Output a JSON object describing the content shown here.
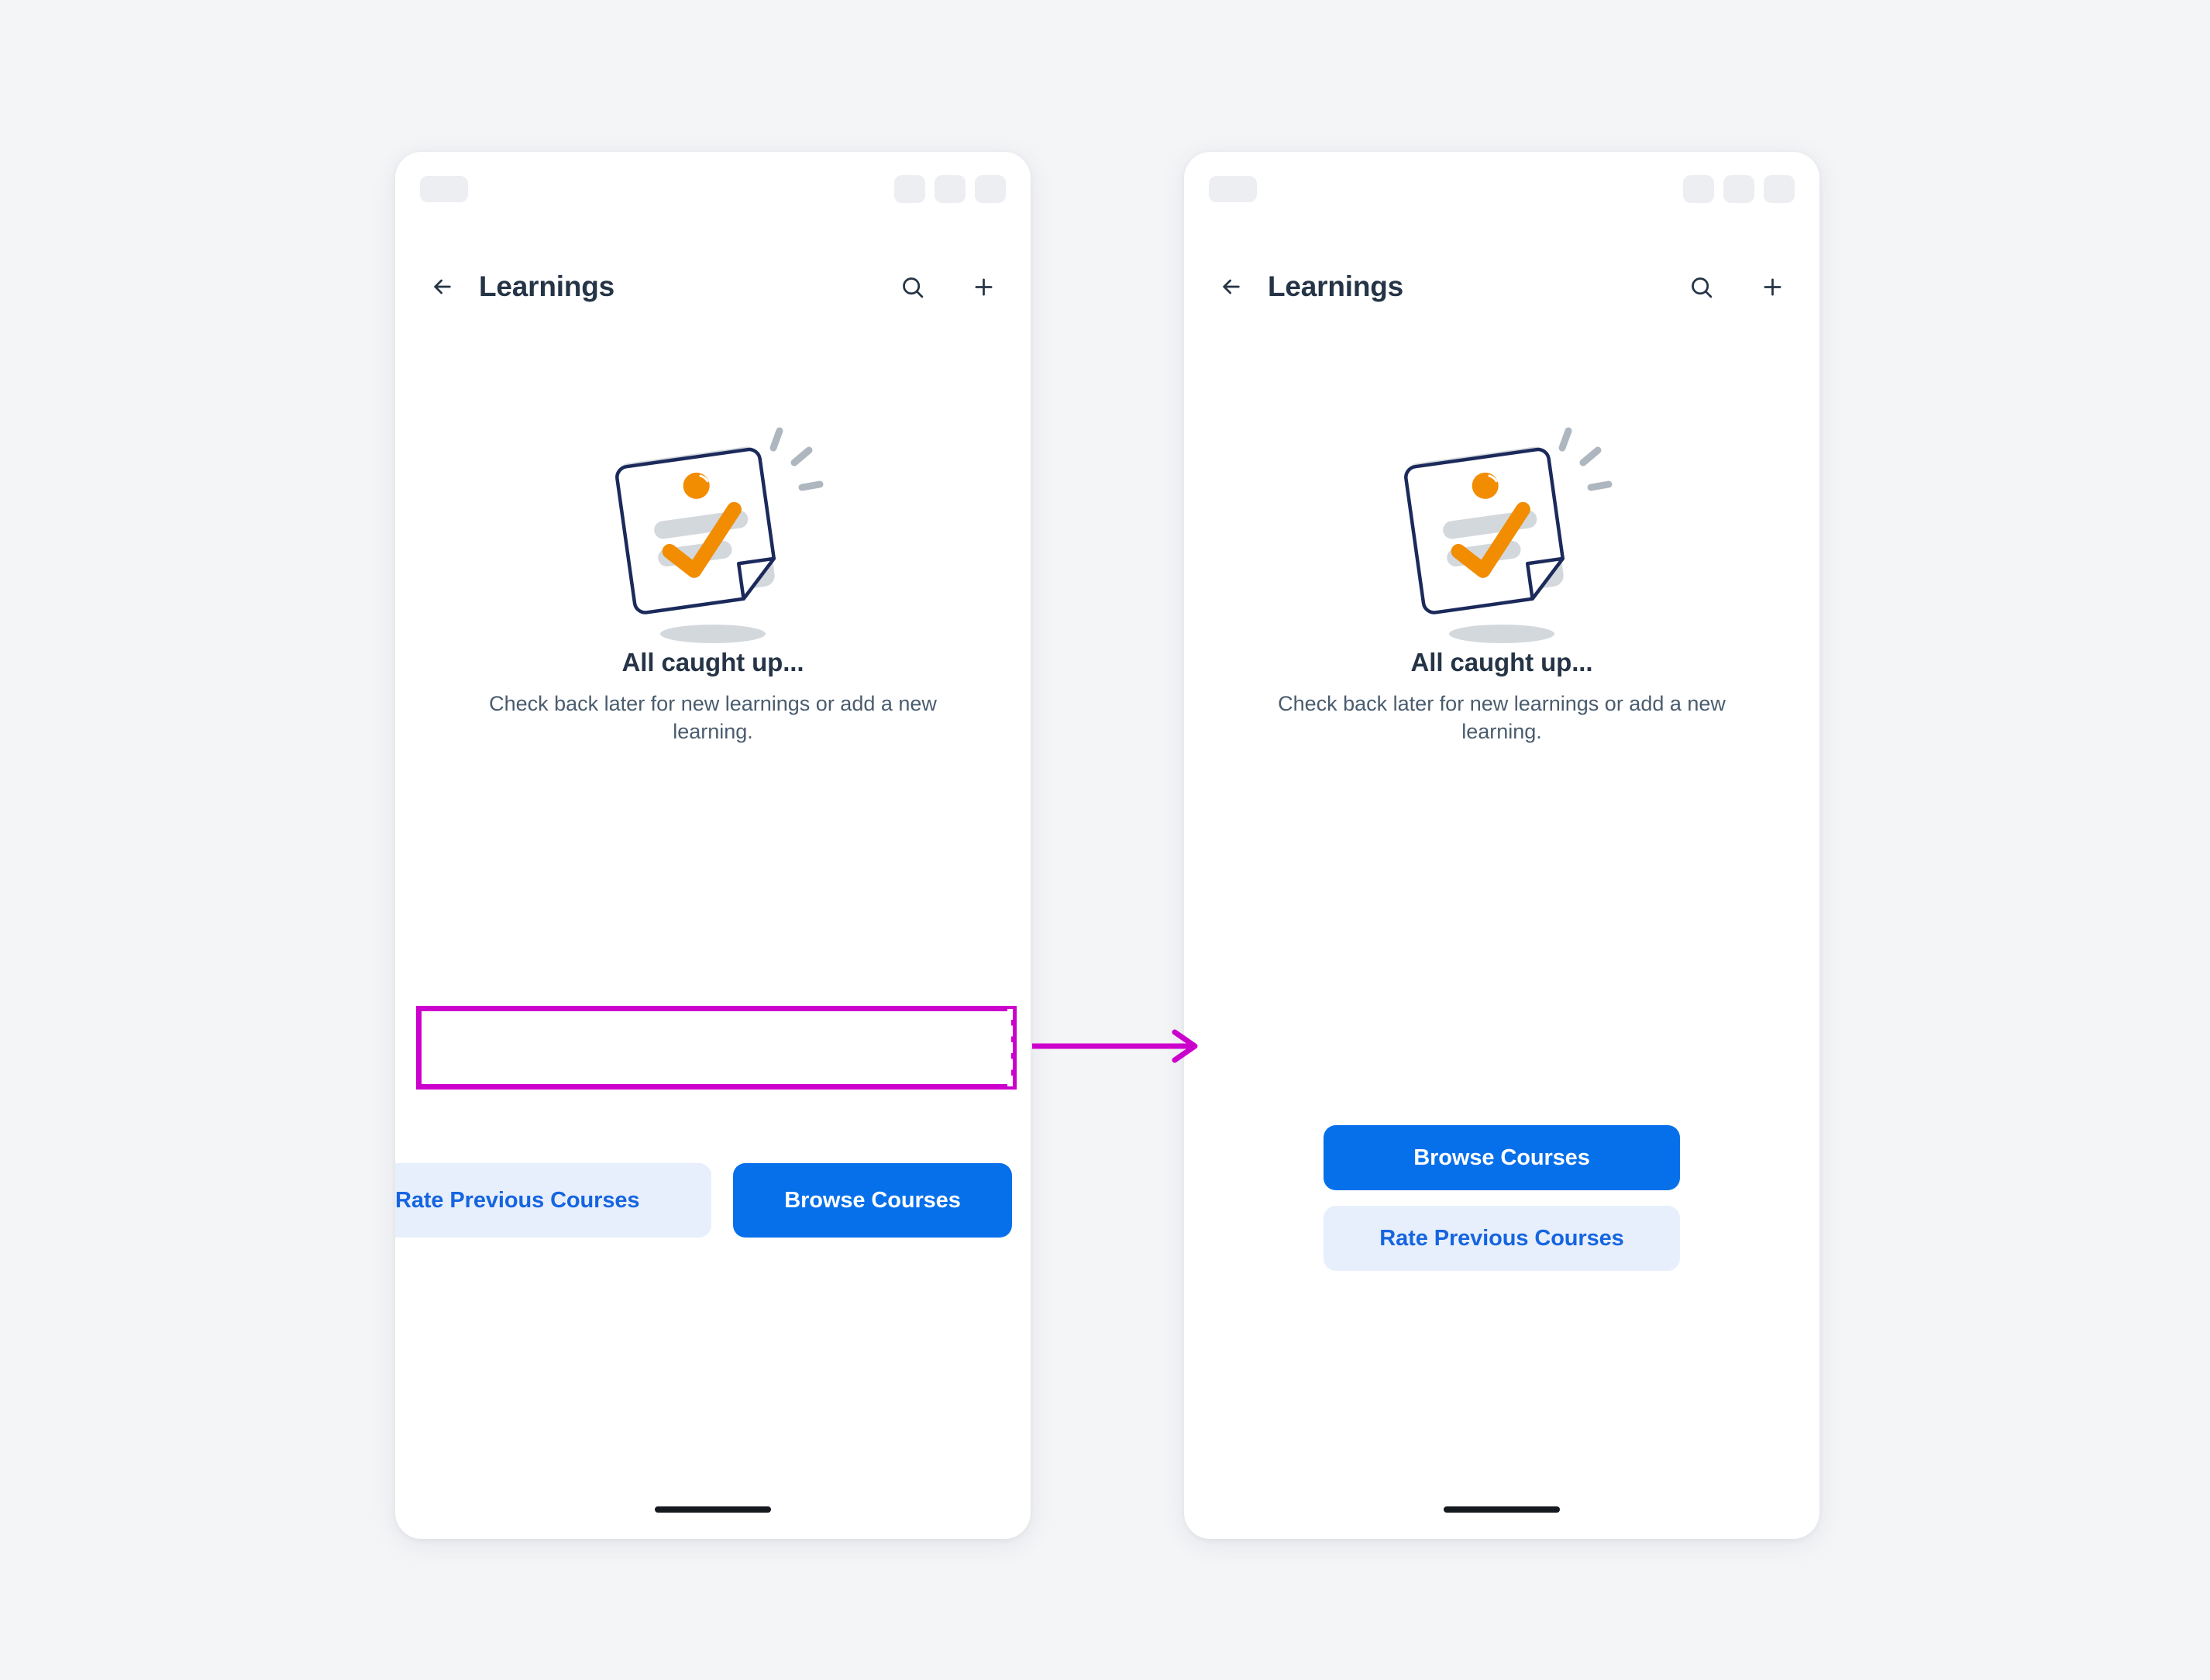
{
  "page": {
    "background_color": "#f4f5f7"
  },
  "colors": {
    "primary_blue": "#0670eb",
    "secondary_blue_bg": "#e8effc",
    "secondary_blue_text": "#1565e0",
    "heading_navy": "#253446",
    "body_slate": "#4a5c6e",
    "illustration_orange": "#f28c00",
    "illustration_navy": "#1b2a5b",
    "illustration_gray": "#d3d8dd",
    "annotation_magenta": "#cc00cc",
    "status_pill_gray": "#eceef2"
  },
  "screens": [
    {
      "id": "before",
      "statusbar": {
        "left_pill": "signal-pill",
        "right_pills": [
          "status-pill-1",
          "status-pill-2",
          "status-pill-3"
        ]
      },
      "appbar": {
        "back_icon": "arrow-left-icon",
        "title": "Learnings",
        "search_icon": "search-icon",
        "add_icon": "plus-icon"
      },
      "illustration": {
        "name": "all-caught-up-note-illustration",
        "elements": [
          "note-card",
          "orange-dot",
          "gray-text-bars",
          "orange-checkmark",
          "folded-corner",
          "sparkle-lines",
          "ground-shadow"
        ]
      },
      "empty_state": {
        "title": "All caught up...",
        "body": "Check back later for new learnings or add a new learning."
      },
      "buttons": [
        {
          "label": "Rate Previous Courses",
          "style": "secondary"
        },
        {
          "label": "Browse Courses",
          "style": "primary"
        }
      ],
      "layout": "horizontal-row-overflow",
      "home_indicator": "home-indicator"
    },
    {
      "id": "after",
      "statusbar": {
        "left_pill": "signal-pill",
        "right_pills": [
          "status-pill-1",
          "status-pill-2",
          "status-pill-3"
        ]
      },
      "appbar": {
        "back_icon": "arrow-left-icon",
        "title": "Learnings",
        "search_icon": "search-icon",
        "add_icon": "plus-icon"
      },
      "illustration": {
        "name": "all-caught-up-note-illustration",
        "elements": [
          "note-card",
          "orange-dot",
          "gray-text-bars",
          "orange-checkmark",
          "folded-corner",
          "sparkle-lines",
          "ground-shadow"
        ]
      },
      "empty_state": {
        "title": "All caught up...",
        "body": "Check back later for new learnings or add a new learning."
      },
      "buttons": [
        {
          "label": "Browse Courses",
          "style": "primary"
        },
        {
          "label": "Rate Previous Courses",
          "style": "secondary"
        }
      ],
      "layout": "vertical-stack",
      "home_indicator": "home-indicator"
    }
  ],
  "annotation": {
    "highlight_target": "button-row",
    "marker_type": "rectangle-outline",
    "cut_line": "dashed-overflow-line",
    "arrow": "points-right-to-fixed-screen"
  }
}
